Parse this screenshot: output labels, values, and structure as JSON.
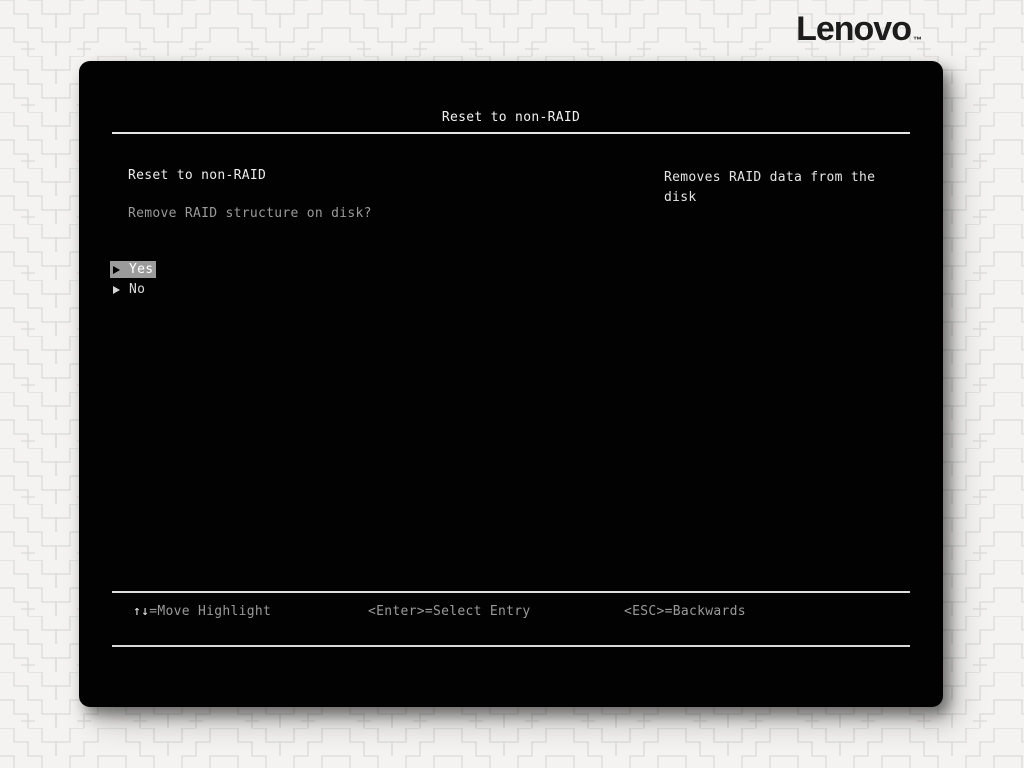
{
  "brand": {
    "logo_text": "Lenovo",
    "trademark": "™"
  },
  "window": {
    "title": "Reset to non-RAID",
    "item": {
      "label": "Reset to non-RAID",
      "question": "Remove RAID structure on disk?"
    },
    "help_panel": {
      "text": "Removes RAID data from the disk"
    },
    "options": [
      {
        "label": "Yes",
        "selected": true
      },
      {
        "label": "No",
        "selected": false
      }
    ],
    "hotkeys": [
      {
        "keys": "↑↓",
        "action": "=Move Highlight"
      },
      {
        "keys": "<Enter>",
        "action": "=Select Entry"
      },
      {
        "keys": "<ESC>",
        "action": "=Backwards"
      }
    ]
  },
  "colors": {
    "page_background": "#f4f3f1",
    "pattern_line": "#dbdbd9",
    "window_background": "#020202",
    "text_bright": "#ececec",
    "text_dim": "#9a9a9a",
    "highlight_background": "#9b9b9b",
    "highlight_text": "#ffffff",
    "logo_text": "#1c1c1c"
  }
}
